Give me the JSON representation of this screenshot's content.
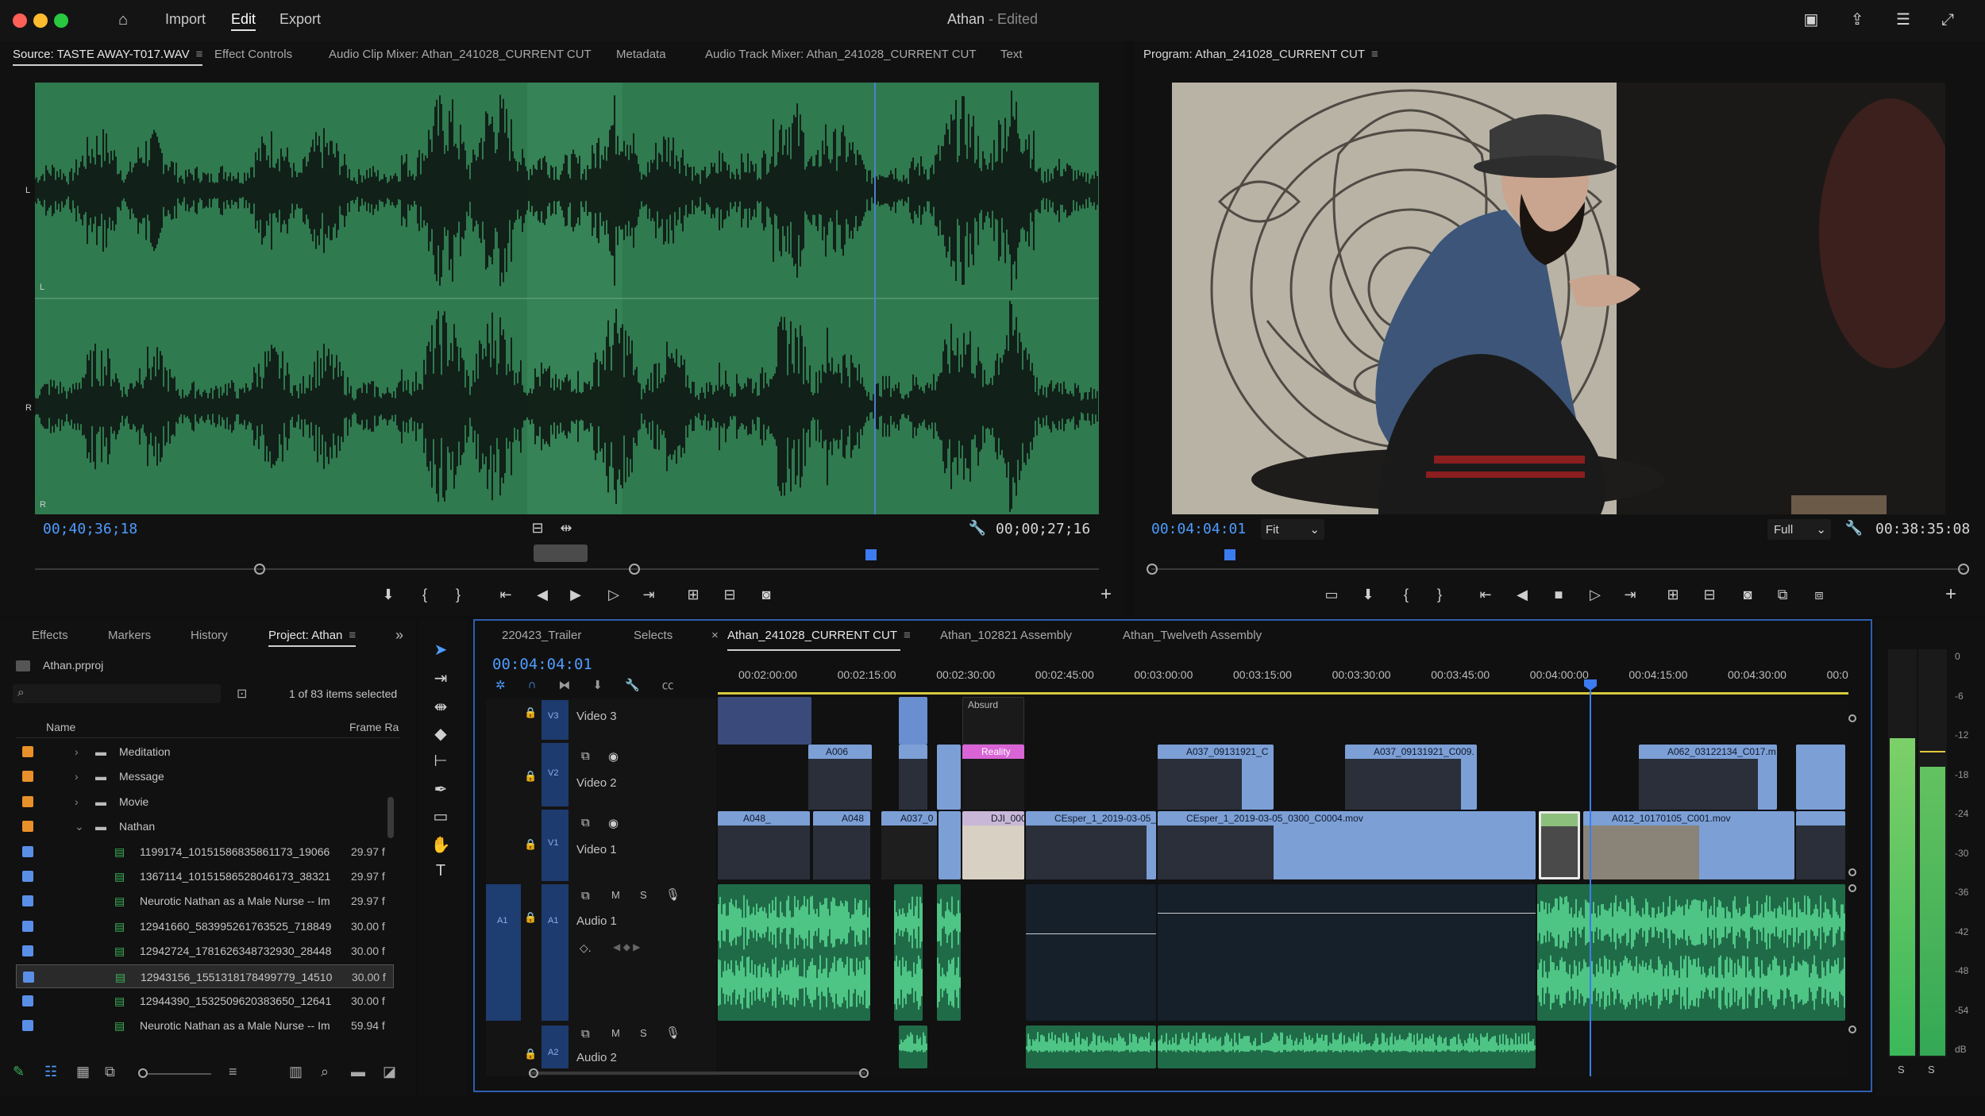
{
  "app": {
    "menu": [
      "Import",
      "Edit",
      "Export"
    ],
    "active_menu": "Edit",
    "title": "Athan",
    "title_suffix": "- Edited"
  },
  "source_panel": {
    "tabs": [
      "Source: TASTE AWAY-T017.WAV",
      "Effect Controls",
      "Audio Clip Mixer: Athan_241028_CURRENT CUT",
      "Metadata",
      "Audio Track Mixer: Athan_241028_CURRENT CUT",
      "Text"
    ],
    "channel_labels": [
      "L",
      "L",
      "R",
      "R"
    ],
    "timecode_current": "00;40;36;18",
    "timecode_duration": "00;00;27;16",
    "playhead_fraction": 0.79
  },
  "program_panel": {
    "tab": "Program: Athan_241028_CURRENT CUT",
    "timecode_current": "00:04:04:01",
    "fit": "Fit",
    "resolution": "Full",
    "timecode_duration": "00:38:35:08"
  },
  "project_panel": {
    "tabs": [
      "Effects",
      "Markers",
      "History",
      "Project: Athan"
    ],
    "project_file": "Athan.prproj",
    "selection_info": "1 of 83 items selected",
    "columns": {
      "name": "Name",
      "frame_rate": "Frame Ra"
    },
    "items": [
      {
        "name": "Meditation",
        "type": "folder",
        "color": "#e8902a",
        "fr": ""
      },
      {
        "name": "Message",
        "type": "folder",
        "color": "#e8902a",
        "fr": ""
      },
      {
        "name": "Movie",
        "type": "folder",
        "color": "#e8902a",
        "fr": ""
      },
      {
        "name": "Nathan",
        "type": "folder",
        "color": "#e8902a",
        "fr": ""
      },
      {
        "name": "1199174_10151586835861173_19066",
        "type": "seq",
        "color": "#5a8fe8",
        "fr": "29.97 f"
      },
      {
        "name": "1367114_10151586528046173_38321",
        "type": "seq",
        "color": "#5a8fe8",
        "fr": "29.97 f"
      },
      {
        "name": "Neurotic Nathan as a Male Nurse -- Im",
        "type": "seq",
        "color": "#5a8fe8",
        "fr": "29.97 f"
      },
      {
        "name": "12941660_583995261763525_718849",
        "type": "seq",
        "color": "#5a8fe8",
        "fr": "30.00 f"
      },
      {
        "name": "12942724_1781626348732930_28448",
        "type": "seq",
        "color": "#5a8fe8",
        "fr": "30.00 f"
      },
      {
        "name": "12943156_1551318178499779_14510",
        "type": "seq",
        "color": "#5a8fe8",
        "fr": "30.00 f"
      },
      {
        "name": "12944390_1532509620383650_12641",
        "type": "seq",
        "color": "#5a8fe8",
        "fr": "30.00 f"
      },
      {
        "name": "Neurotic Nathan as a Male Nurse -- Im",
        "type": "seq",
        "color": "#5a8fe8",
        "fr": "59.94 f"
      }
    ]
  },
  "timeline": {
    "tabs": [
      "220423_Trailer",
      "Selects",
      "Athan_241028_CURRENT CUT",
      "Athan_102821 Assembly",
      "Athan_Twelveth Assembly"
    ],
    "active_tab": "Athan_241028_CURRENT CUT",
    "timecode": "00:04:04:01",
    "ruler": [
      "00:02:00:00",
      "00:02:15:00",
      "00:02:30:00",
      "00:02:45:00",
      "00:03:00:00",
      "00:03:15:00",
      "00:03:30:00",
      "00:03:45:00",
      "00:04:00:00",
      "00:04:15:00",
      "00:04:30:00",
      "00:0"
    ],
    "tracks": {
      "v3": {
        "id": "V3",
        "name": "Video 3"
      },
      "v2": {
        "id": "V2",
        "name": "Video 2"
      },
      "v1": {
        "id": "V1",
        "name": "Video 1"
      },
      "a1": {
        "id": "A1",
        "name": "Audio 1",
        "src": "A1"
      },
      "a2": {
        "id": "A2",
        "name": "Audio 2"
      }
    },
    "clips": {
      "v2": [
        "A006",
        "Reality",
        "A037_09131921_C",
        "A037_09131921_C009.",
        "A062_03122134_C017.m"
      ],
      "v1": [
        "A048_",
        "A048",
        "A037_0",
        "DJI_000",
        "CEsper_1_2019-03-05_",
        "CEsper_1_2019-03-05_0300_C0004.mov",
        "A012_10170105_C001.mov"
      ],
      "v3": [
        "Absurd"
      ]
    },
    "msm": [
      "M",
      "S"
    ]
  },
  "meters": {
    "scale": [
      "0",
      "-6",
      "-12",
      "-18",
      "-24",
      "-30",
      "-36",
      "-42",
      "-48",
      "-54",
      "dB"
    ],
    "solo": [
      "S",
      "S"
    ]
  }
}
